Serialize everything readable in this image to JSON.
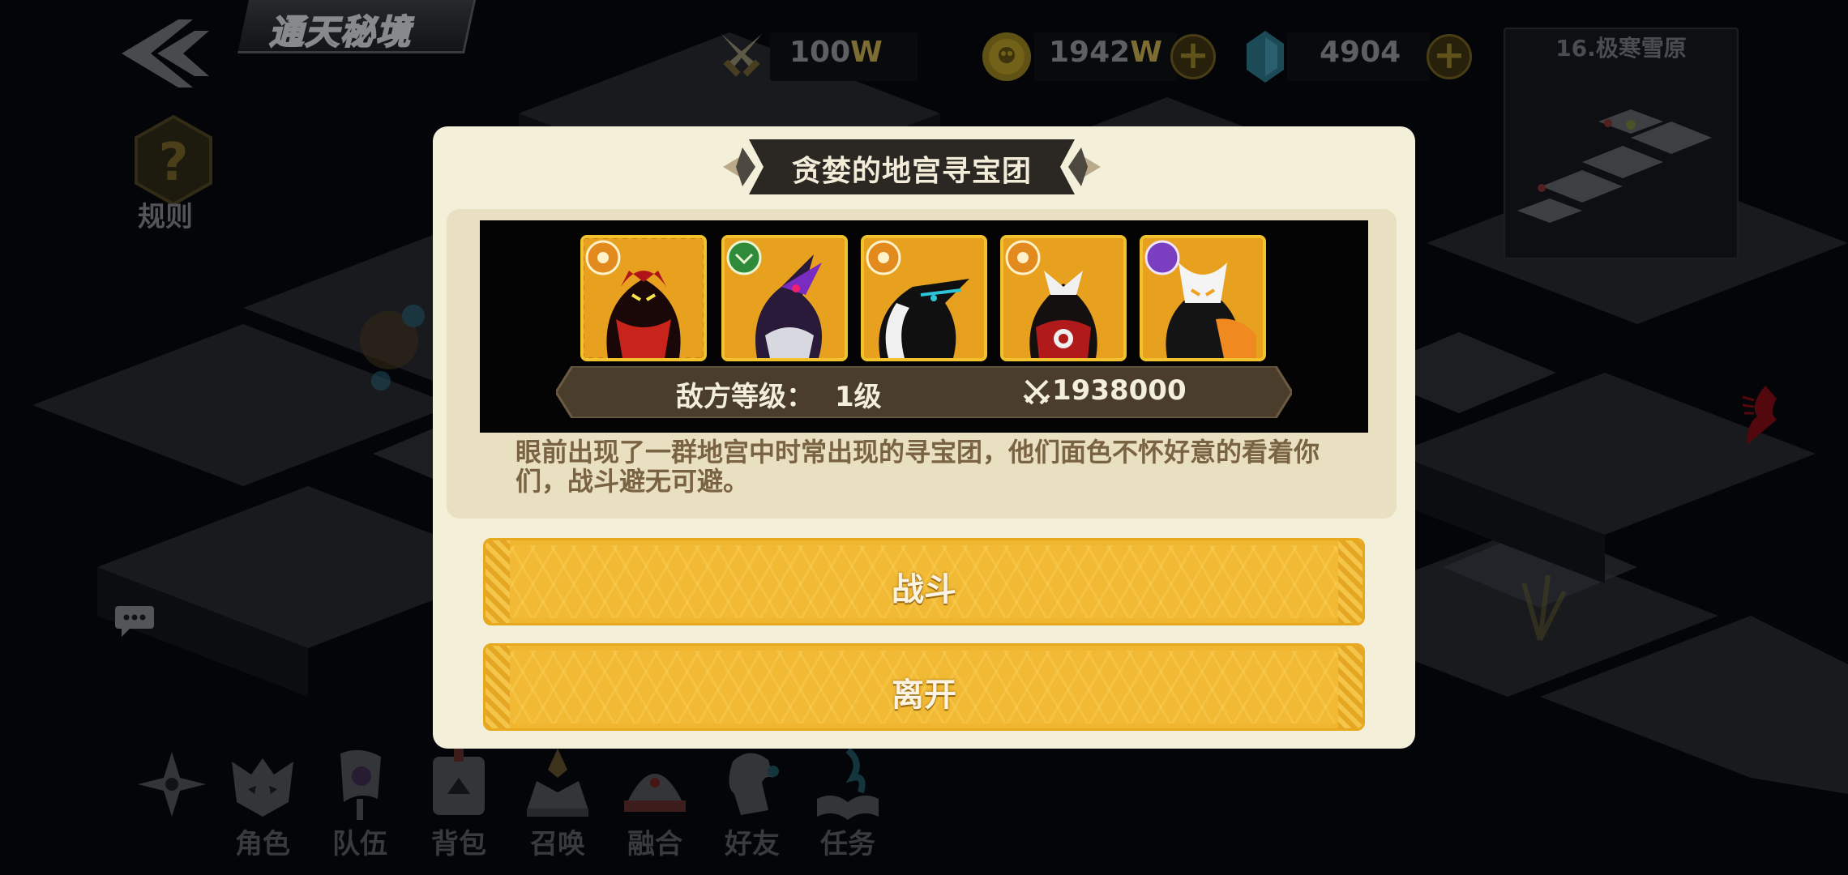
{
  "header": {
    "title": "通天秘境"
  },
  "resources": [
    {
      "icon": "swords-icon",
      "value": "100",
      "unit": "W"
    },
    {
      "icon": "gold-coin-icon",
      "value": "1942",
      "unit": "W"
    },
    {
      "icon": "blue-gem-icon",
      "value": "4904",
      "unit": ""
    }
  ],
  "add_symbol": "+",
  "minimap": {
    "title": "16.极寒雪原"
  },
  "rules": {
    "label": "规则",
    "icon": "question-icon"
  },
  "nav": [
    {
      "label": "",
      "icon": "shuriken-icon"
    },
    {
      "label": "角色",
      "icon": "wolf-head-icon"
    },
    {
      "label": "队伍",
      "icon": "banner-icon"
    },
    {
      "label": "背包",
      "icon": "backpack-icon"
    },
    {
      "label": "召唤",
      "icon": "summon-altar-icon"
    },
    {
      "label": "融合",
      "icon": "fusion-dome-icon"
    },
    {
      "label": "好友",
      "icon": "friend-dragon-icon"
    },
    {
      "label": "任务",
      "icon": "quest-book-icon"
    }
  ],
  "dialog": {
    "title": "贪婪的地宫寻宝团",
    "enemies": [
      {
        "element": "sun",
        "badge_color": "#e38a1f",
        "theme": "#c8241c"
      },
      {
        "element": "nature",
        "badge_color": "#2f8a3a",
        "theme": "#7a2bc0"
      },
      {
        "element": "sun",
        "badge_color": "#e38a1f",
        "theme": "#2ec5d8"
      },
      {
        "element": "sun",
        "badge_color": "#e38a1f",
        "theme": "#b01a1a"
      },
      {
        "element": "moon",
        "badge_color": "#7a3fc0",
        "theme": "#f0f0f0"
      }
    ],
    "enemy_level_label": "敌方等级：",
    "enemy_level_value": "1级",
    "power_value": "1938000",
    "description": "眼前出现了一群地宫中时常出现的寻宝团，他们面色不怀好意的看着你们，战斗避无可避。",
    "fight_label": "战斗",
    "leave_label": "离开"
  },
  "colors": {
    "dialog_bg": "#f4efd8",
    "button_gold": "#f0b62f",
    "frame_gold": "#f1c22d",
    "desc_text": "#7a6342"
  }
}
